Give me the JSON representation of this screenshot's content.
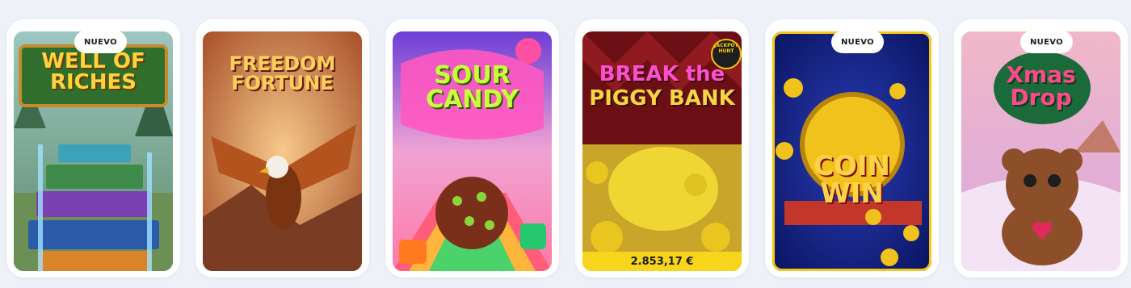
{
  "games": [
    {
      "name": "well-of-riches",
      "badge": "NUEVO",
      "title_lines": [
        "WELL OF",
        "RICHES"
      ]
    },
    {
      "name": "freedom-fortune",
      "badge": "",
      "title_lines": [
        "FREEDOM",
        "FORTUNE"
      ]
    },
    {
      "name": "sour-candy",
      "badge": "",
      "title_lines": [
        "SOUR",
        "CANDY"
      ]
    },
    {
      "name": "break-the-piggy-bank",
      "badge": "",
      "title_lines": [
        "BREAK the",
        "PIGGY BANK"
      ],
      "provider_badge": "JACKPOT HUNT",
      "jackpot": "2.853,17 €"
    },
    {
      "name": "coin-win",
      "badge": "NUEVO",
      "title_lines": [
        "COIN",
        "WIN"
      ]
    },
    {
      "name": "xmas-drop",
      "badge": "NUEVO",
      "title_lines": [
        "Xmas",
        "Drop"
      ]
    }
  ],
  "colors": {
    "page_bg": "#eef1f8",
    "card_bg": "#ffffff",
    "jackpot_bar": "#f7d51d",
    "coin_win_border": "#f5c518"
  }
}
